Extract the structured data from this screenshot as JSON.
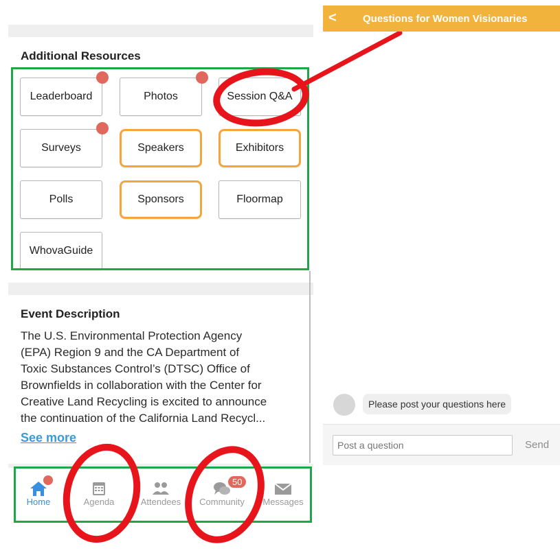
{
  "resources": {
    "title": "Additional Resources",
    "buttons": [
      "Leaderboard",
      "Photos",
      "Session Q&A",
      "Surveys",
      "Speakers",
      "Exhibitors",
      "Polls",
      "Sponsors",
      "Floormap",
      "WhovaGuide"
    ]
  },
  "event": {
    "title": "Event Description",
    "lines": [
      "The U.S. Environmental Protection Agency",
      "(EPA) Region 9 and the CA Department of",
      "Toxic Substances Control’s (DTSC) Office of",
      "Brownfields in collaboration with the Center for",
      "Creative Land Recycling is excited to announce",
      "the continuation of the California Land Recycl..."
    ],
    "see_more": "See more"
  },
  "nav": {
    "home": "Home",
    "agenda": "Agenda",
    "attendees": "Attendees",
    "community": "Community",
    "community_badge": "50",
    "messages": "Messages"
  },
  "qa": {
    "back_glyph": "<",
    "title": "Questions for Women Visionaries",
    "bubble": "Please post your questions here",
    "input_placeholder": "Post a question",
    "send": "Send"
  },
  "colors": {
    "header": "#f2b33d",
    "highlight_orange": "#f4a63c",
    "annotation_green": "#1fa64a",
    "annotation_red": "#e8141b",
    "notification_dot": "#e0685c",
    "home_active": "#3a8fe0"
  }
}
